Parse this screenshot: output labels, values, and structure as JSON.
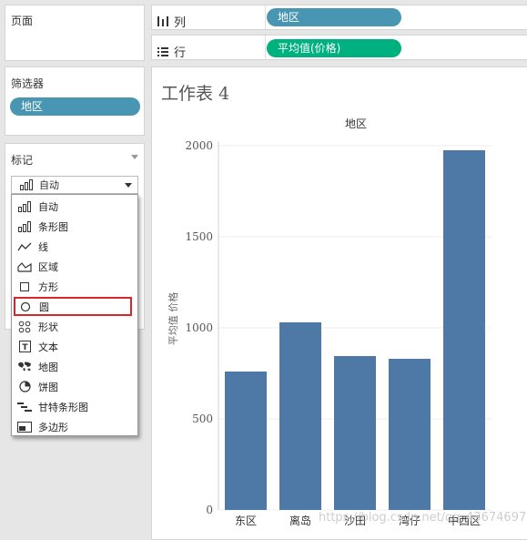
{
  "pages": {
    "title": "页面"
  },
  "filters": {
    "title": "筛选器",
    "pill": "地区"
  },
  "marks": {
    "title": "标记",
    "dropdown_value": "自动",
    "menu": [
      {
        "label": "自动",
        "icon": "auto-icon"
      },
      {
        "label": "条形图",
        "icon": "bar-icon"
      },
      {
        "label": "线",
        "icon": "line-icon"
      },
      {
        "label": "区域",
        "icon": "area-icon"
      },
      {
        "label": "方形",
        "icon": "square-icon"
      },
      {
        "label": "圆",
        "icon": "circle-icon",
        "highlighted": true
      },
      {
        "label": "形状",
        "icon": "shape-icon"
      },
      {
        "label": "文本",
        "icon": "text-icon"
      },
      {
        "label": "地图",
        "icon": "map-icon"
      },
      {
        "label": "饼图",
        "icon": "pie-icon"
      },
      {
        "label": "甘特条形图",
        "icon": "gantt-icon"
      },
      {
        "label": "多边形",
        "icon": "polygon-icon"
      }
    ]
  },
  "shelves": {
    "columns": {
      "label": "列",
      "pill": "地区"
    },
    "rows": {
      "label": "行",
      "pill": "平均值(价格)"
    }
  },
  "sheet": {
    "title": "工作表 4"
  },
  "colors": {
    "blue_pill": "#4996b2",
    "green_pill": "#00b180",
    "bar": "#4e79a7",
    "highlight_border": "#d9262a"
  },
  "watermark": "https://blog.csdn.net/qq_43674697",
  "chart_data": {
    "type": "bar",
    "title": "地区",
    "xlabel": "",
    "ylabel": "平均值 价格",
    "categories": [
      "东区",
      "离岛",
      "沙田",
      "湾仔",
      "中西区"
    ],
    "values": [
      760,
      1030,
      845,
      830,
      1975
    ],
    "ylim": [
      0,
      2000
    ],
    "yticks": [
      0,
      500,
      1000,
      1500,
      2000
    ],
    "ytick_labels": [
      "0",
      "500",
      "1000",
      "1500",
      "2000"
    ],
    "grid": true
  }
}
